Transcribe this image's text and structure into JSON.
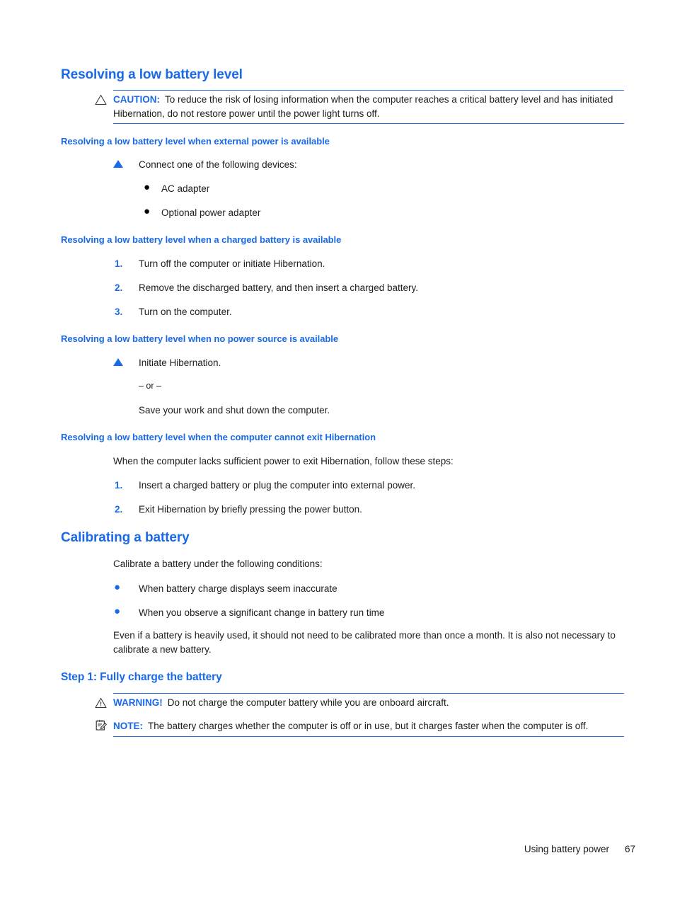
{
  "document": {
    "section_heading": "Resolving a low battery level",
    "caution": {
      "icon": "caution-triangle-icon",
      "label": "CAUTION:",
      "text": "To reduce the risk of losing information when the computer reaches a critical battery level and has initiated Hibernation, do not restore power until the power light turns off."
    },
    "subsection_external_power": {
      "heading": "Resolving a low battery level when external power is available",
      "lead": "Connect one of the following devices:",
      "bullets": [
        "AC adapter",
        "Optional power adapter"
      ]
    },
    "subsection_charged_battery": {
      "heading": "Resolving a low battery level when a charged battery is available",
      "steps": [
        {
          "num": "1.",
          "text": "Turn off the computer or initiate Hibernation."
        },
        {
          "num": "2.",
          "text": "Remove the discharged battery, and then insert a charged battery."
        },
        {
          "num": "3.",
          "text": "Turn on the computer."
        }
      ]
    },
    "subsection_no_power": {
      "heading": "Resolving a low battery level when no power source is available",
      "option_one": "Initiate Hibernation.",
      "or_separator": "– or –",
      "option_two": "Save your work and shut down the computer."
    },
    "subsection_cannot_exit": {
      "heading": "Resolving a low battery level when the computer cannot exit Hibernation",
      "lead": "When the computer lacks sufficient power to exit Hibernation, follow these steps:",
      "steps": [
        {
          "num": "1.",
          "text": "Insert a charged battery or plug the computer into external power."
        },
        {
          "num": "2.",
          "text": "Exit Hibernation by briefly pressing the power button."
        }
      ]
    },
    "calibrating": {
      "heading": "Calibrating a battery",
      "lead": "Calibrate a battery under the following conditions:",
      "bullets": [
        "When battery charge displays seem inaccurate",
        "When you observe a significant change in battery run time"
      ],
      "note_paragraph": "Even if a battery is heavily used, it should not need to be calibrated more than once a month. It is also not necessary to calibrate a new battery."
    },
    "step1": {
      "heading": "Step 1: Fully charge the battery",
      "warning": {
        "icon": "warning-triangle-icon",
        "label": "WARNING!",
        "text": "Do not charge the computer battery while you are onboard aircraft."
      },
      "note": {
        "icon": "note-pad-icon",
        "label": "NOTE:",
        "text": "The battery charges whether the computer is off or in use, but it charges faster when the computer is off."
      }
    },
    "footer": {
      "running_head": "Using battery power",
      "page_number": "67"
    },
    "colors": {
      "heading_blue": "#1a6ae8",
      "rule_blue": "#2a72e0",
      "body_black": "#1c1c1c"
    },
    "markers": {
      "triangle": "triangle-bullet-icon",
      "bullet": "•"
    }
  }
}
